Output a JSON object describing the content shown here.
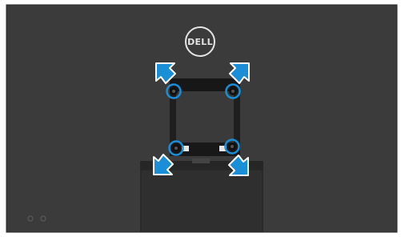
{
  "brand": {
    "logo_text": "DELL",
    "logo_color": "#e4e4e4"
  },
  "colors": {
    "monitor_back": "#3b3b3b",
    "bracket_dark": "#1f1f1f",
    "stand": "#303030",
    "accent": "#1a8fd8"
  },
  "icons": {
    "mount_screw": "screw-icon",
    "remove_direction": "diagonal-arrow-icon"
  }
}
